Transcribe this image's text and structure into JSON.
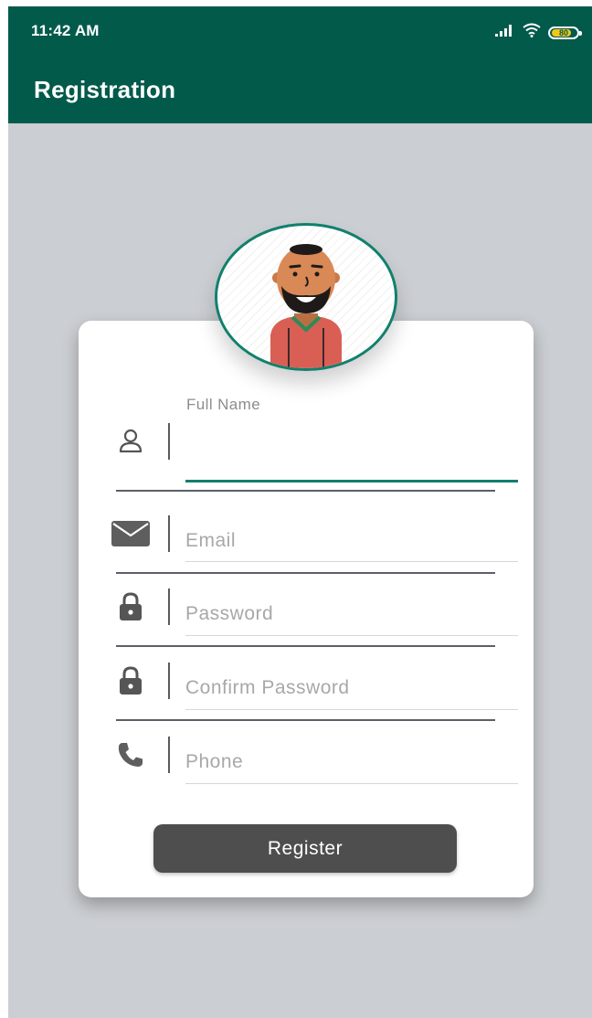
{
  "status_bar": {
    "time": "11:42 AM",
    "battery_level": "80",
    "icons": [
      "signal-icon",
      "wifi-icon",
      "battery-icon"
    ]
  },
  "app_bar": {
    "title": "Registration"
  },
  "avatar": {
    "icon": "user-avatar-illustration",
    "border_color": "#11806d"
  },
  "form": {
    "fields": [
      {
        "icon": "person-icon",
        "label": "Full Name",
        "placeholder": "",
        "value": "",
        "focused": true
      },
      {
        "icon": "email-icon",
        "label": "",
        "placeholder": "Email",
        "value": "",
        "focused": false
      },
      {
        "icon": "lock-icon",
        "label": "",
        "placeholder": "Password",
        "value": "",
        "focused": false
      },
      {
        "icon": "lock-icon",
        "label": "",
        "placeholder": "Confirm Password",
        "value": "",
        "focused": false
      },
      {
        "icon": "phone-icon",
        "label": "",
        "placeholder": "Phone",
        "value": "",
        "focused": false
      }
    ],
    "register_label": "Register"
  },
  "colors": {
    "primary": "#025a4b",
    "accent": "#11806d",
    "background": "#cbced2",
    "button": "#4e4e4e"
  }
}
